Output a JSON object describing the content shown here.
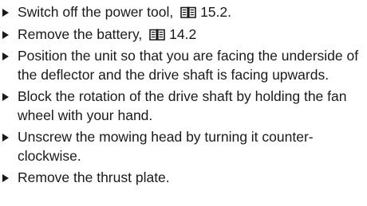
{
  "cut_off_top_line": "",
  "steps": [
    {
      "pre": "Switch off the power tool, ",
      "ref": "15.2",
      "post": "."
    },
    {
      "pre": "Remove the battery, ",
      "ref": "14.2",
      "post": ""
    },
    {
      "text": "Position the unit so that you are facing the underside of the deflector and the drive shaft is facing upwards."
    },
    {
      "text": "Block the rotation of the drive shaft by holding the fan wheel with your hand."
    },
    {
      "text": "Unscrew the mowing head by turning it counter­clockwise."
    },
    {
      "text": "Remove the thrust plate."
    }
  ],
  "icons": {
    "reference": "book-icon",
    "bullet": "triangle-bullet-icon"
  }
}
